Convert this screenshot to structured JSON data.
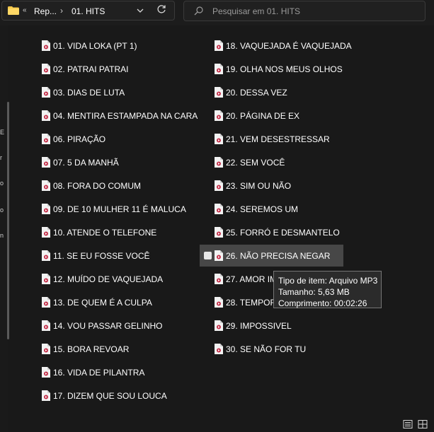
{
  "breadcrumb": {
    "back_glyph": "«",
    "parent": "Rep...",
    "separator": "›",
    "current": "01. HITS"
  },
  "search": {
    "placeholder": "Pesquisar em 01. HITS"
  },
  "nav_chars": [
    "E",
    "r",
    "o",
    "o",
    "n"
  ],
  "files_col1": [
    "01. VIDA LOKA (PT 1)",
    "02. PATRAI PATRAI",
    "03. DIAS DE LUTA",
    "04. MENTIRA ESTAMPADA NA CARA",
    "06. PIRAÇÃO",
    "07. 5 DA MANHÃ",
    "08. FORA DO COMUM",
    "09. DE 10 MULHER 11 É MALUCA",
    "10. ATENDE O TELEFONE",
    "11. SE EU FOSSE VOCÊ",
    "12. MUÍDO DE VAQUEJADA",
    "13. DE QUEM É A CULPA",
    "14. VOU PASSAR GELINHO",
    "15. BORA REVOAR",
    "16. VIDA DE PILANTRA",
    "17. DIZEM QUE SOU LOUCA"
  ],
  "files_col2": [
    "18. VAQUEJADA É VAQUEJADA",
    "19. OLHA NOS MEUS OLHOS",
    "20. DESSA VEZ",
    "20. PÁGINA DE EX",
    "21. VEM DESESTRESSAR",
    "22. SEM VOCÊ",
    "23. SIM OU NÃO",
    "24. SEREMOS UM",
    "25. FORRÓ E DESMANTELO",
    "26. NÃO PRECISA NEGAR",
    "27. AMOR IM",
    "28. TEMPORA",
    "29. IMPOSSIVEL",
    "30. SE NÃO FOR TU"
  ],
  "tooltip": {
    "type": "Tipo de item: Arquivo MP3",
    "size": "Tamanho: 5,63 MB",
    "length": "Comprimento: 00:02:26"
  },
  "colors": {
    "background": "#191919",
    "selection": "#474747",
    "folder": "#f4c84a",
    "file_icon_accent": "#c4314b"
  },
  "icons": {
    "folder": "folder-icon",
    "file": "audio-file-icon",
    "refresh": "refresh-icon",
    "search": "search-icon",
    "dropdown": "chevron-down-icon",
    "view_details": "details-view-icon",
    "view_tiles": "tiles-view-icon"
  }
}
